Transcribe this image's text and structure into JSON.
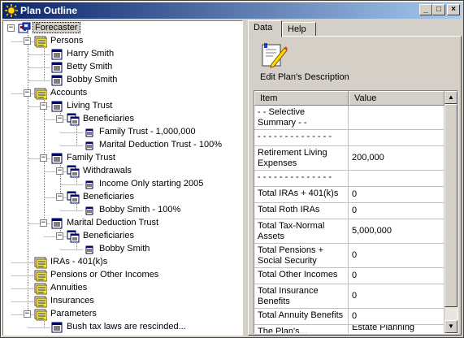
{
  "window": {
    "title": "Plan Outline"
  },
  "tree": [
    {
      "label": "Forecaster",
      "level": 0,
      "expander": "−",
      "icon": "forecaster-icon",
      "selected": true
    },
    {
      "label": "Persons",
      "level": 1,
      "expander": "−",
      "icon": "folder-icon"
    },
    {
      "label": "Harry Smith",
      "level": 2,
      "icon": "document-icon"
    },
    {
      "label": "Betty Smith",
      "level": 2,
      "icon": "document-icon"
    },
    {
      "label": "Bobby Smith",
      "level": 2,
      "icon": "document-icon"
    },
    {
      "label": "Accounts",
      "level": 1,
      "expander": "−",
      "icon": "folder-icon"
    },
    {
      "label": "Living Trust",
      "level": 2,
      "expander": "−",
      "icon": "document-icon"
    },
    {
      "label": "Beneficiaries",
      "level": 3,
      "expander": "−",
      "icon": "beneficiaries-icon"
    },
    {
      "label": "Family Trust - 1,000,000",
      "level": 4,
      "icon": "item-icon"
    },
    {
      "label": "Marital Deduction Trust - 100%",
      "level": 4,
      "icon": "item-icon"
    },
    {
      "label": "Family Trust",
      "level": 2,
      "expander": "−",
      "icon": "document-icon"
    },
    {
      "label": "Withdrawals",
      "level": 3,
      "expander": "−",
      "icon": "beneficiaries-icon"
    },
    {
      "label": "Income Only starting 2005",
      "level": 4,
      "icon": "item-icon"
    },
    {
      "label": "Beneficiaries",
      "level": 3,
      "expander": "−",
      "icon": "beneficiaries-icon"
    },
    {
      "label": "Bobby Smith - 100%",
      "level": 4,
      "icon": "item-icon"
    },
    {
      "label": "Marital Deduction Trust",
      "level": 2,
      "expander": "−",
      "icon": "document-icon"
    },
    {
      "label": "Beneficiaries",
      "level": 3,
      "expander": "−",
      "icon": "beneficiaries-icon"
    },
    {
      "label": "Bobby Smith",
      "level": 4,
      "icon": "item-icon"
    },
    {
      "label": "IRAs - 401(k)s",
      "level": 1,
      "icon": "folder-icon"
    },
    {
      "label": "Pensions or Other Incomes",
      "level": 1,
      "icon": "folder-icon"
    },
    {
      "label": "Annuities",
      "level": 1,
      "icon": "folder-icon"
    },
    {
      "label": "Insurances",
      "level": 1,
      "icon": "folder-icon"
    },
    {
      "label": "Parameters",
      "level": 1,
      "expander": "−",
      "icon": "folder-icon"
    },
    {
      "label": "Bush tax laws are rescinded...",
      "level": 2,
      "icon": "document-icon"
    }
  ],
  "tabs": [
    {
      "label": "Data",
      "active": true
    },
    {
      "label": "Help",
      "active": false
    }
  ],
  "description_button": {
    "label": "Edit Plan's Description",
    "icon": "edit-pencil-icon"
  },
  "grid": {
    "columns": [
      "Item",
      "Value"
    ],
    "rows": [
      {
        "item": " - - Selective Summary - -",
        "value": "",
        "lines": 2
      },
      {
        "item": " - - - - - - - - - - - - - -",
        "value": "",
        "lines": 1
      },
      {
        "item": "Retirement Living Expenses",
        "value": "200,000",
        "lines": 2
      },
      {
        "item": " - - - - - - - - - - - - - -",
        "value": "",
        "lines": 1
      },
      {
        "item": "Total IRAs + 401(k)s",
        "value": "0",
        "lines": 1
      },
      {
        "item": "Total Roth IRAs",
        "value": "0",
        "lines": 1
      },
      {
        "item": "Total Tax-Normal Assets",
        "value": "5,000,000",
        "lines": 2
      },
      {
        "item": "Total Pensions + Social Security",
        "value": "0",
        "lines": 2
      },
      {
        "item": "Total Other Incomes",
        "value": "0",
        "lines": 1
      },
      {
        "item": "Total Insurance Benefits",
        "value": "0",
        "lines": 2
      },
      {
        "item": "Total Annuity Benefits",
        "value": "0",
        "lines": 1
      },
      {
        "item": "The Plan's...",
        "value": "Estate Planning With...",
        "lines": 1
      }
    ]
  },
  "colors": {
    "title_start": "#0a246a",
    "title_end": "#a6caf0",
    "face": "#d4d0c8",
    "window": "#ffffff"
  }
}
